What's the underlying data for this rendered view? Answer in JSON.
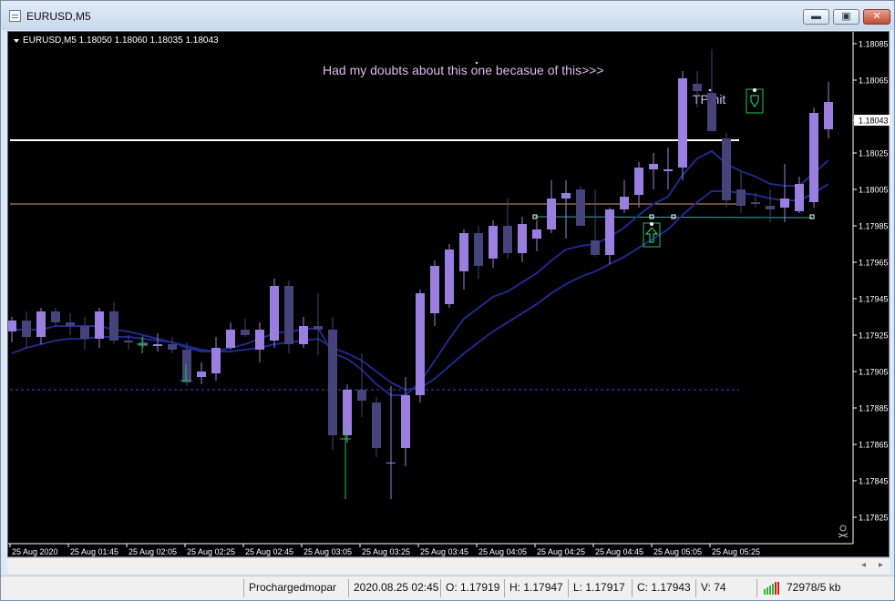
{
  "window": {
    "title": "EURUSD,M5",
    "minimize_glyph": "▬",
    "maximize_glyph": "▣",
    "close_glyph": "✕"
  },
  "chart": {
    "header": "EURUSD,M5  1.18050 1.18060 1.18035 1.18043",
    "symbol_label": "EURUSD,M5",
    "colors": {
      "background": "#000000",
      "bull_candle": "#9b7fe0",
      "bear_candle": "#45437a",
      "ma": "#1e2a8c",
      "axis_text": "#ffffff",
      "resistance_line": "#ffffff",
      "sl_line": "#d9a06a",
      "trend_line": "#3ea6a8",
      "entry_level": "#3848c8",
      "signal_green": "#22c35a",
      "annotation": "#e2b6f2"
    },
    "annotations": {
      "doubts_text": "Had my doubts about this one becasue of this>>>",
      "tp_text": "TP hit"
    },
    "levels": {
      "resistance": 1.18032,
      "stop": 1.17997,
      "trend_y": 1.1799,
      "entry_dashed": 1.17895,
      "current_price": 1.18043
    }
  },
  "chart_data": {
    "type": "candlestick",
    "title": "EURUSD,M5",
    "y_axis_ticks": [
      1.18085,
      1.18065,
      1.18043,
      1.18025,
      1.18005,
      1.17985,
      1.17965,
      1.17945,
      1.17925,
      1.17905,
      1.17885,
      1.17865,
      1.17845,
      1.17825
    ],
    "ylim": [
      1.1782,
      1.1809
    ],
    "x_axis_labels": [
      "25 Aug 2020",
      "25 Aug 01:45",
      "25 Aug 02:05",
      "25 Aug 02:25",
      "25 Aug 02:45",
      "25 Aug 03:05",
      "25 Aug 03:25",
      "25 Aug 03:45",
      "25 Aug 04:05",
      "25 Aug 04:25",
      "25 Aug 04:45",
      "25 Aug 05:05",
      "25 Aug 05:25"
    ],
    "candles": [
      [
        1.17927,
        1.17935,
        1.17921,
        1.17933
      ],
      [
        1.17933,
        1.17938,
        1.17918,
        1.17924
      ],
      [
        1.17924,
        1.1794,
        1.1792,
        1.17938
      ],
      [
        1.17938,
        1.1794,
        1.1793,
        1.17932
      ],
      [
        1.17932,
        1.17937,
        1.17925,
        1.1793
      ],
      [
        1.1793,
        1.17935,
        1.17917,
        1.17923
      ],
      [
        1.17923,
        1.1794,
        1.17918,
        1.17938
      ],
      [
        1.17938,
        1.17943,
        1.1792,
        1.17922
      ],
      [
        1.17922,
        1.17925,
        1.17917,
        1.17921
      ],
      [
        1.17921,
        1.17925,
        1.17918,
        1.17919
      ],
      [
        1.17919,
        1.17926,
        1.17916,
        1.1792
      ],
      [
        1.1792,
        1.17924,
        1.17915,
        1.17917
      ],
      [
        1.17917,
        1.17921,
        1.17897,
        1.17899
      ],
      [
        1.17902,
        1.1791,
        1.17898,
        1.17905
      ],
      [
        1.17904,
        1.17924,
        1.179,
        1.17918
      ],
      [
        1.17918,
        1.17932,
        1.17917,
        1.17928
      ],
      [
        1.17928,
        1.17934,
        1.17924,
        1.17925
      ],
      [
        1.17917,
        1.17932,
        1.1791,
        1.17928
      ],
      [
        1.17922,
        1.17956,
        1.17918,
        1.17952
      ],
      [
        1.17952,
        1.17955,
        1.17915,
        1.1792
      ],
      [
        1.1792,
        1.17935,
        1.17918,
        1.1793
      ],
      [
        1.1793,
        1.17948,
        1.17914,
        1.17928
      ],
      [
        1.17928,
        1.17935,
        1.17862,
        1.1787
      ],
      [
        1.1787,
        1.17898,
        1.17866,
        1.17895
      ],
      [
        1.17895,
        1.17915,
        1.1788,
        1.17889
      ],
      [
        1.17888,
        1.17891,
        1.17858,
        1.17863
      ],
      [
        1.17855,
        1.17897,
        1.17835,
        1.17855
      ],
      [
        1.17863,
        1.17902,
        1.17853,
        1.17892
      ],
      [
        1.17892,
        1.1795,
        1.17888,
        1.17948
      ],
      [
        1.17937,
        1.17966,
        1.1793,
        1.17963
      ],
      [
        1.17942,
        1.17975,
        1.1794,
        1.17972
      ],
      [
        1.1796,
        1.17983,
        1.1795,
        1.17981
      ],
      [
        1.17981,
        1.17985,
        1.17956,
        1.17963
      ],
      [
        1.17967,
        1.17988,
        1.17962,
        1.17985
      ],
      [
        1.17985,
        1.18,
        1.17967,
        1.1797
      ],
      [
        1.1797,
        1.1799,
        1.17965,
        1.17986
      ],
      [
        1.17978,
        1.17988,
        1.17971,
        1.17983
      ],
      [
        1.17983,
        1.1801,
        1.17981,
        1.18
      ],
      [
        1.18,
        1.1801,
        1.17978,
        1.18003
      ],
      [
        1.18005,
        1.18007,
        1.17985,
        1.17985
      ],
      [
        1.17977,
        1.18005,
        1.17968,
        1.17969
      ],
      [
        1.17969,
        1.17995,
        1.17964,
        1.17994
      ],
      [
        1.17994,
        1.1801,
        1.17992,
        1.18001
      ],
      [
        1.18002,
        1.1802,
        1.17995,
        1.18017
      ],
      [
        1.18016,
        1.18025,
        1.18005,
        1.18019
      ],
      [
        1.18015,
        1.18028,
        1.18005,
        1.18016
      ],
      [
        1.18017,
        1.1807,
        1.1801,
        1.18066
      ],
      [
        1.18063,
        1.1807,
        1.1805,
        1.18059
      ],
      [
        1.18058,
        1.18082,
        1.18037,
        1.18037
      ],
      [
        1.18033,
        1.18036,
        1.17995,
        1.17999
      ],
      [
        1.18005,
        1.18015,
        1.17992,
        1.17996
      ],
      [
        1.17998,
        1.18003,
        1.17995,
        1.17997
      ],
      [
        1.17996,
        1.18005,
        1.17987,
        1.17994
      ],
      [
        1.17995,
        1.18019,
        1.17987,
        1.18
      ],
      [
        1.17993,
        1.18012,
        1.17992,
        1.18008
      ],
      [
        1.17998,
        1.1805,
        1.17995,
        1.18047
      ],
      [
        1.18038,
        1.18064,
        1.18033,
        1.18053
      ]
    ],
    "series": [
      {
        "values": [
          1.17928,
          1.17928,
          1.17928,
          1.1793,
          1.1793,
          1.1793,
          1.1793,
          1.17928,
          1.17927,
          1.17925,
          1.17923,
          1.17921,
          1.17918,
          1.17916,
          1.17916,
          1.17918,
          1.1792,
          1.17923,
          1.17926,
          1.17927,
          1.17928,
          1.17929,
          1.17915,
          1.17912,
          1.17906,
          1.17898,
          1.17892,
          1.17892,
          1.17899,
          1.17911,
          1.17923,
          1.17934,
          1.1794,
          1.17946,
          1.17949,
          1.17954,
          1.17959,
          1.17966,
          1.17972,
          1.17974,
          1.17975,
          1.17979,
          1.17984,
          1.17991,
          1.17997,
          1.18001,
          1.18013,
          1.18022,
          1.18026,
          1.18019,
          1.18015,
          1.18012,
          1.18008,
          1.18007,
          1.18007,
          1.18014,
          1.18021
        ]
      },
      {
        "values": [
          1.17915,
          1.17918,
          1.1792,
          1.17922,
          1.17923,
          1.17923,
          1.17924,
          1.17924,
          1.17924,
          1.17923,
          1.17922,
          1.17921,
          1.17919,
          1.17917,
          1.17916,
          1.17916,
          1.17917,
          1.17918,
          1.1792,
          1.17921,
          1.17922,
          1.17923,
          1.17918,
          1.17915,
          1.17911,
          1.17905,
          1.17899,
          1.17895,
          1.17896,
          1.17901,
          1.17908,
          1.17915,
          1.17921,
          1.17927,
          1.17932,
          1.17937,
          1.17942,
          1.17948,
          1.17953,
          1.17957,
          1.1796,
          1.17964,
          1.17968,
          1.17973,
          1.17978,
          1.17983,
          1.17991,
          1.17998,
          1.18004,
          1.18004,
          1.18003,
          1.18002,
          1.18,
          1.17999,
          1.17999,
          1.18003,
          1.18008
        ]
      }
    ]
  },
  "statusbar": {
    "profile": "Prochargedmopar",
    "datetime": "2020.08.25 02:45",
    "open": "O: 1.17919",
    "high": "H: 1.17947",
    "low": "L: 1.17917",
    "close": "C: 1.17943",
    "volume": "V: 74",
    "traffic": "72978/5 kb"
  },
  "scroll": {
    "left_glyph": "◂",
    "right_glyph": "▸"
  }
}
